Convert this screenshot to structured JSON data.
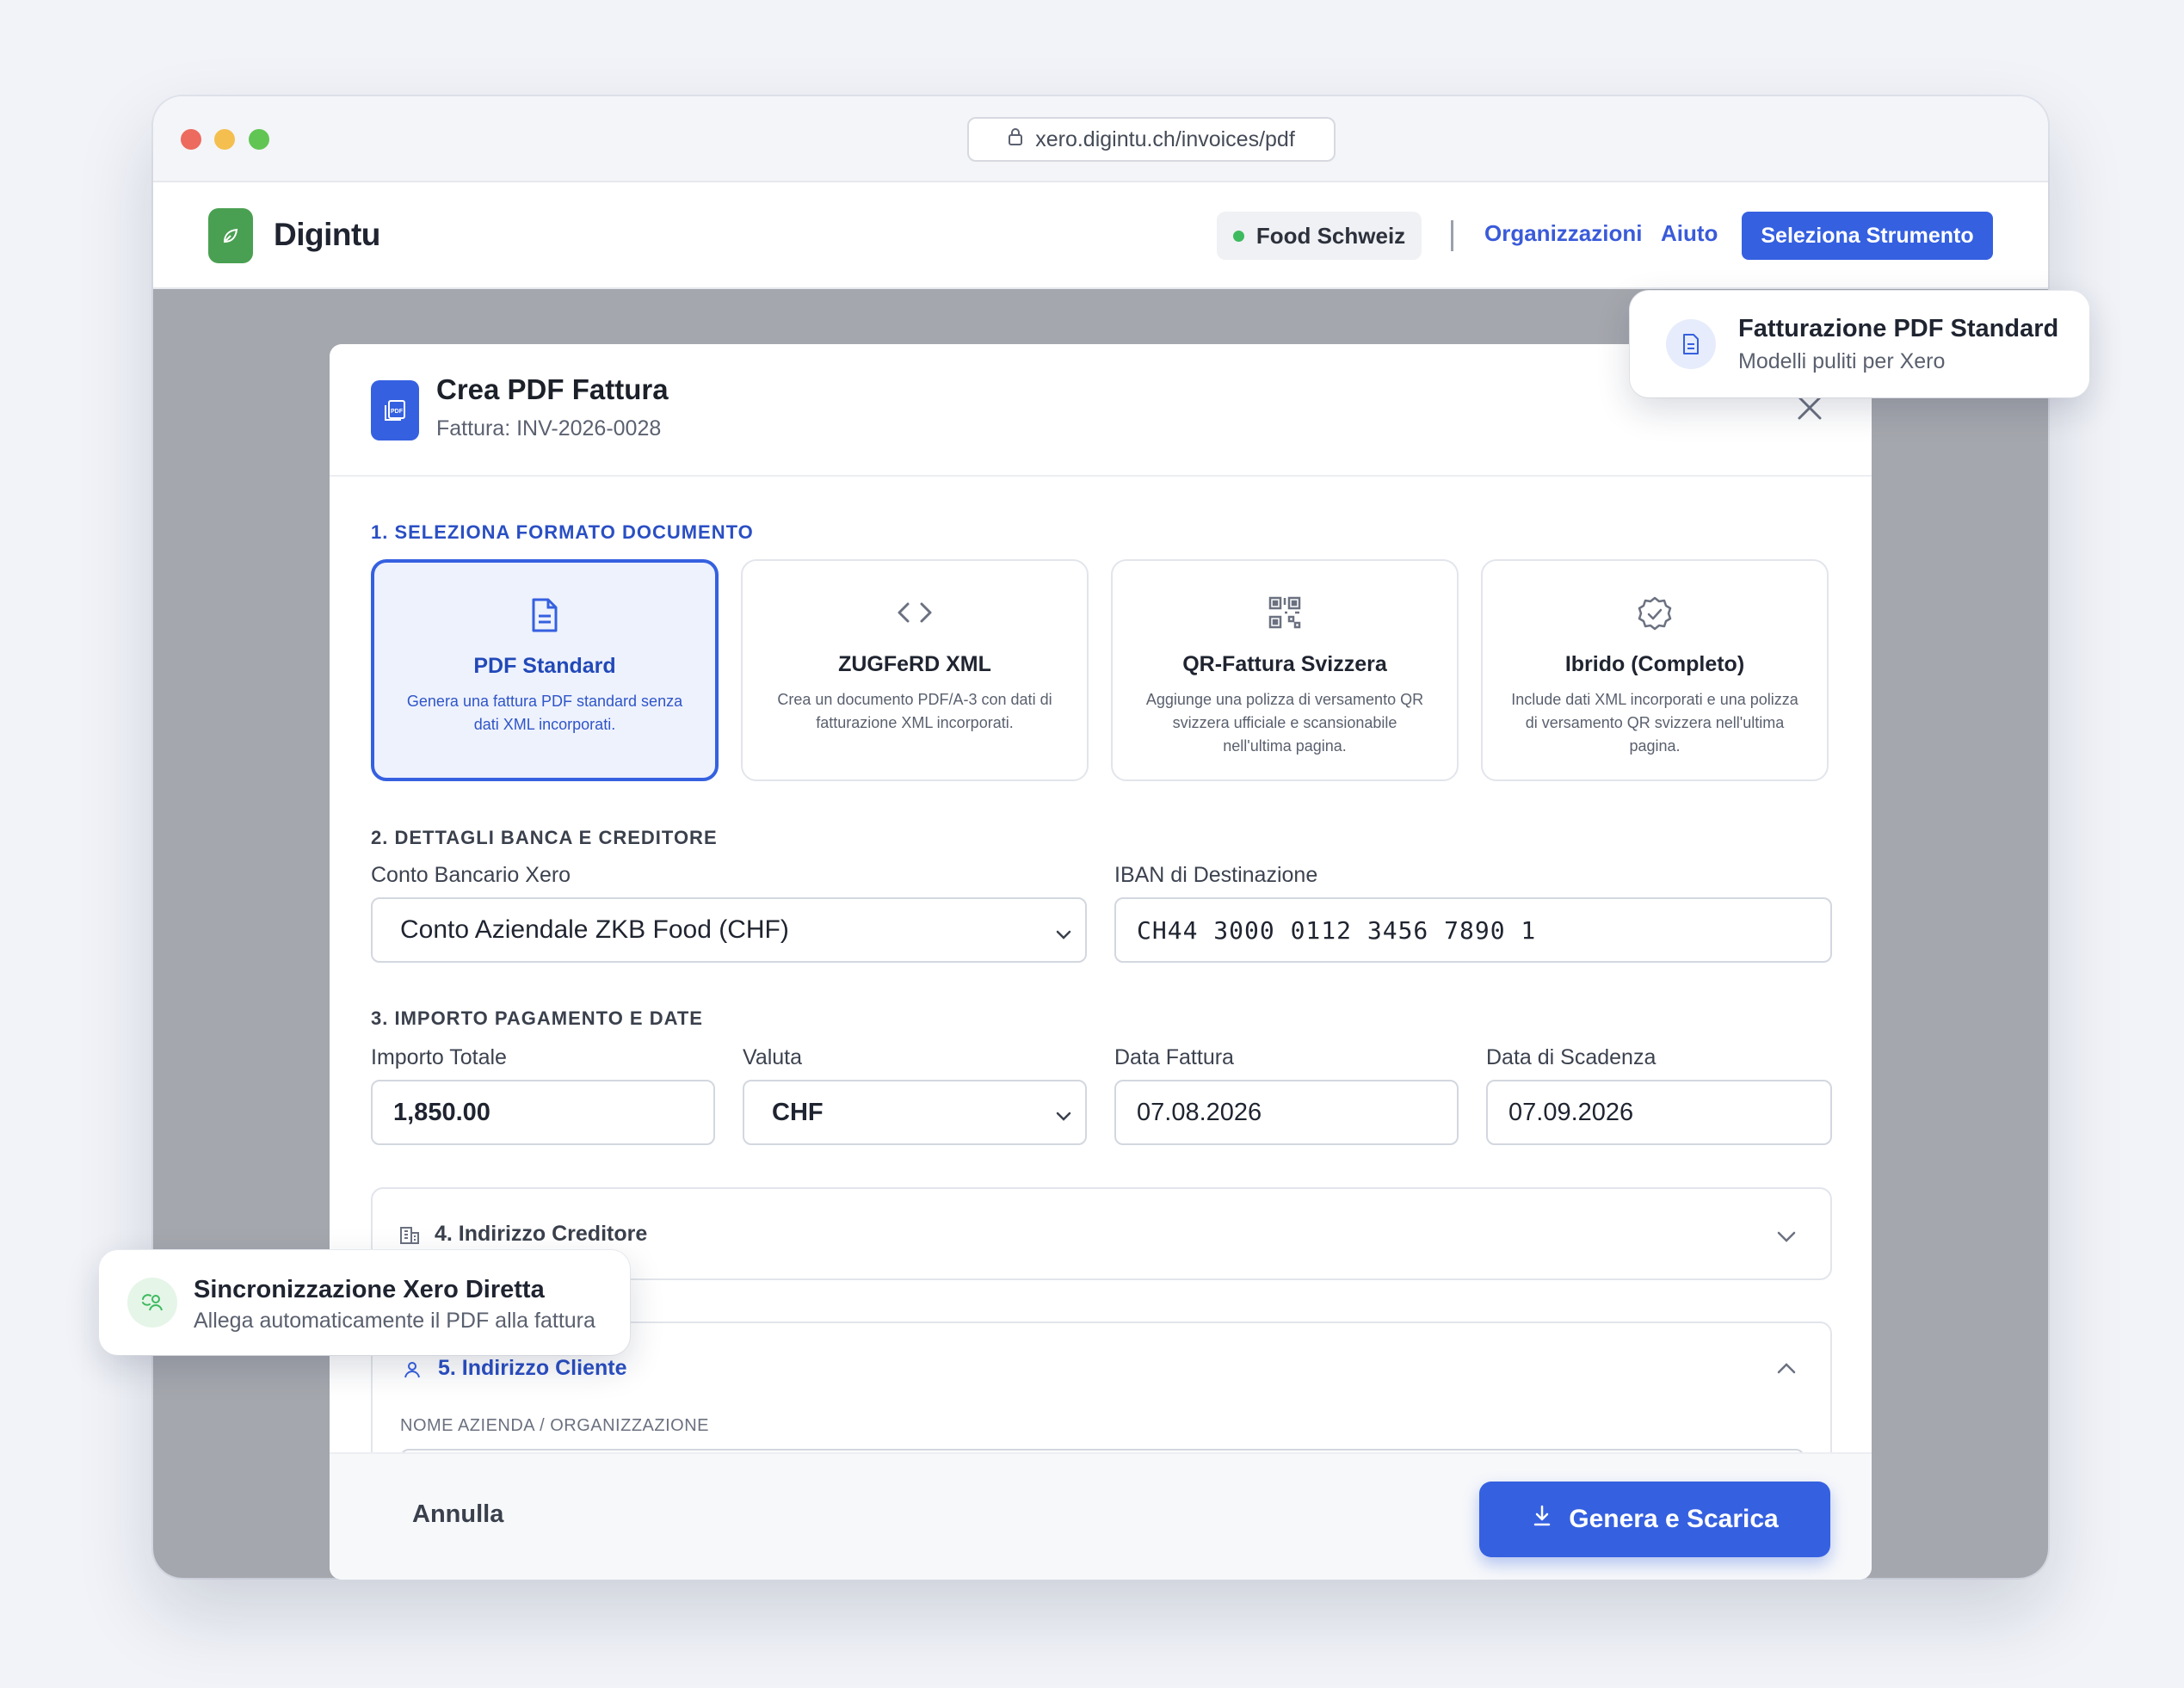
{
  "browser": {
    "url": "xero.digintu.ch/invoices/pdf"
  },
  "header": {
    "brand": "Digintu",
    "organization": "Food Schweiz",
    "nav": [
      "Organizzazioni",
      "Aiuto"
    ],
    "cta": "Seleziona Strumento"
  },
  "modal": {
    "title": "Crea PDF Fattura",
    "subtitle": "Fattura: INV-2026-0028",
    "section1": "1. SELEZIONA FORMATO DOCUMENTO",
    "formats": [
      {
        "title": "PDF Standard",
        "desc": "Genera una fattura PDF standard senza dati XML incorporati.",
        "icon": "document-icon",
        "selected": true
      },
      {
        "title": "ZUGFeRD XML",
        "desc": "Crea un documento PDF/A-3 con dati di fatturazione XML incorporati.",
        "icon": "code-icon",
        "selected": false
      },
      {
        "title": "QR-Fattura Svizzera",
        "desc": "Aggiunge una polizza di versamento QR svizzera ufficiale e scansionabile nell'ultima pagina.",
        "icon": "qr-code-icon",
        "selected": false
      },
      {
        "title": "Ibrido (Completo)",
        "desc": "Include dati XML incorporati e una polizza di versamento QR svizzera nell'ultima pagina.",
        "icon": "badge-check-icon",
        "selected": false
      }
    ],
    "section2": "2. DETTAGLI BANCA E CREDITORE",
    "bank_label": "Conto Bancario Xero",
    "bank_value": "Conto Aziendale ZKB Food (CHF)",
    "iban_label": "IBAN di Destinazione",
    "iban_value": "CH44 3000 0112 3456 7890 1",
    "section3": "3. IMPORTO PAGAMENTO E DATE",
    "amount_label": "Importo Totale",
    "amount_value": "1,850.00",
    "currency_label": "Valuta",
    "currency_value": "CHF",
    "invoice_date_label": "Data Fattura",
    "invoice_date_value": "07.08.2026",
    "due_date_label": "Data di Scadenza",
    "due_date_value": "07.09.2026",
    "section4": "4. Indirizzo Creditore",
    "section5": "5. Indirizzo Cliente",
    "company_label": "NOME AZIENDA / ORGANIZZAZIONE",
    "cancel": "Annulla",
    "generate": "Genera e Scarica"
  },
  "toasts": {
    "pdf": {
      "title": "Fatturazione PDF Standard",
      "sub": "Modelli puliti per Xero"
    },
    "sync": {
      "title": "Sincronizzazione Xero Diretta",
      "sub": "Allega automaticamente il PDF alla fattura"
    }
  },
  "colors": {
    "accent": "#3560e0",
    "brand_green": "#4aa052",
    "overlay": "#a5a7ae"
  }
}
